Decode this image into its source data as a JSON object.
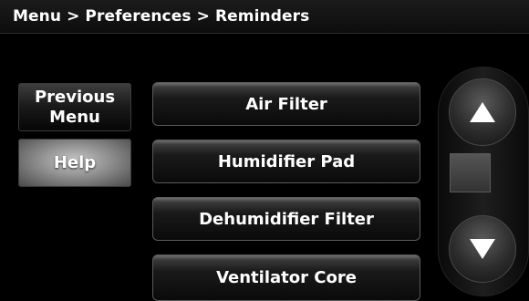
{
  "header": {
    "breadcrumb": "Menu > Preferences > Reminders"
  },
  "sidebar": {
    "previous_menu_line1": "Previous",
    "previous_menu_line2": "Menu",
    "help_label": "Help"
  },
  "list": {
    "items": [
      {
        "label": "Air Filter"
      },
      {
        "label": "Humidifier Pad"
      },
      {
        "label": "Dehumidifier Filter"
      },
      {
        "label": "Ventilator Core"
      }
    ]
  },
  "scroll": {
    "up_icon": "arrow-up-icon",
    "down_icon": "arrow-down-icon"
  }
}
